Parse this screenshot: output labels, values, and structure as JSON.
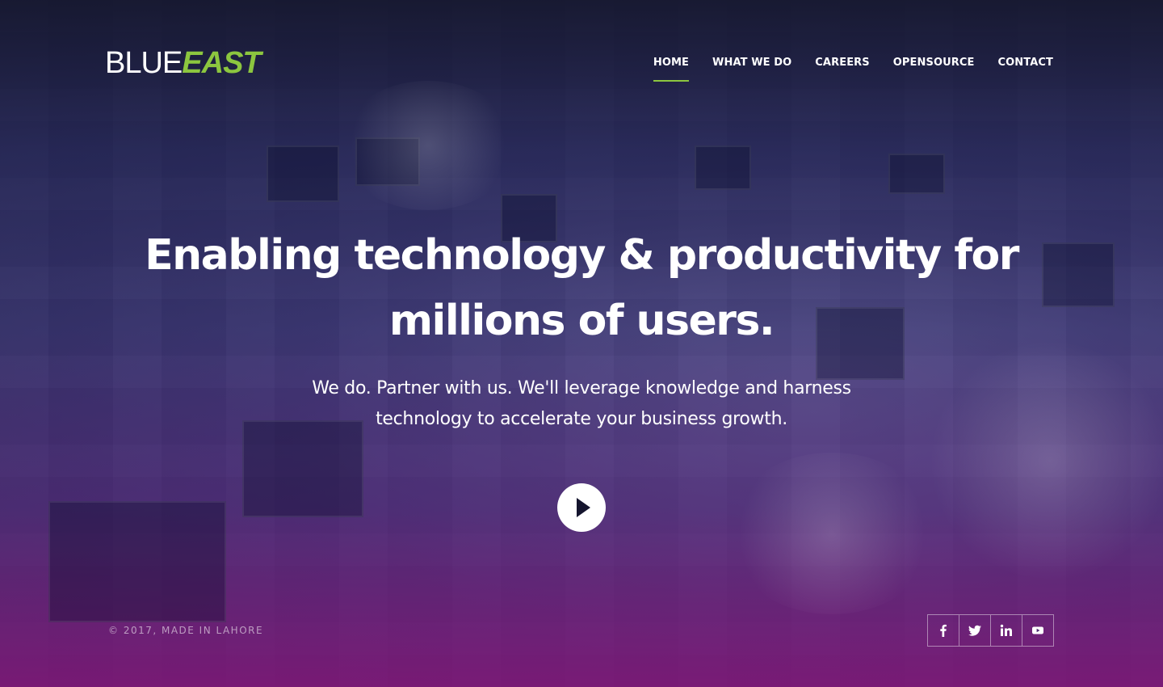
{
  "brand": {
    "logo_part1": "BLUE",
    "logo_part2": "EAST",
    "accent_color": "#8cc63f"
  },
  "nav": {
    "items": [
      {
        "label": "HOME",
        "active": true
      },
      {
        "label": "WHAT WE DO",
        "active": false
      },
      {
        "label": "CAREERS",
        "active": false
      },
      {
        "label": "OPENSOURCE",
        "active": false
      },
      {
        "label": "CONTACT",
        "active": false
      }
    ]
  },
  "hero": {
    "headline_line1": "Enabling technology & productivity for",
    "headline_line2": "millions of users.",
    "subtext_line1": "We do. Partner with us. We'll leverage knowledge and harness",
    "subtext_line2": "technology to accelerate your business growth.",
    "play_icon": "play-icon"
  },
  "footer": {
    "copyright": "© 2017, MADE IN LAHORE",
    "social": [
      {
        "icon": "facebook-icon"
      },
      {
        "icon": "twitter-icon"
      },
      {
        "icon": "linkedin-icon"
      },
      {
        "icon": "youtube-icon"
      }
    ]
  }
}
